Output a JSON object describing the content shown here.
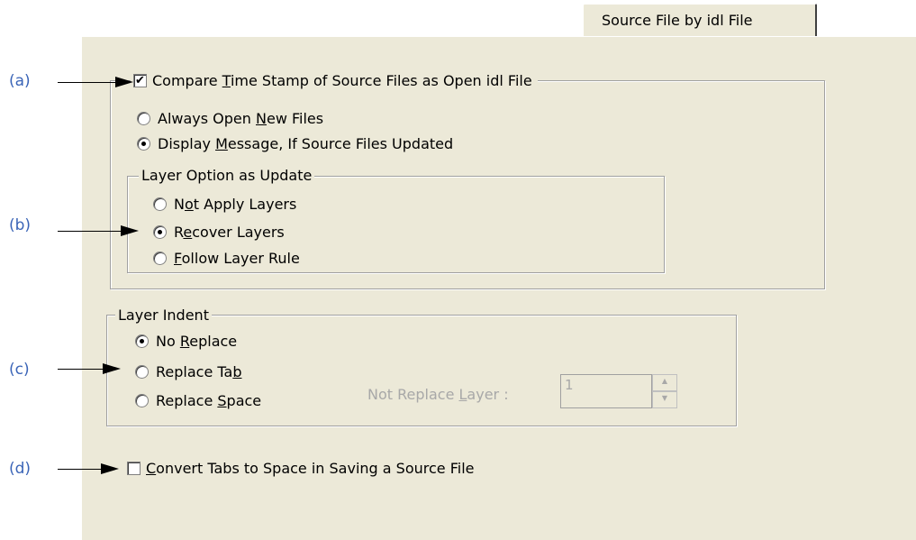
{
  "tab": {
    "label": "Source File by idl File"
  },
  "annotations": {
    "a": "(a)",
    "b": "(b)",
    "c": "(c)",
    "d": "(d)"
  },
  "compare": {
    "checked": true,
    "check_glyph": "✔",
    "label_pre": "Compare ",
    "label_ul": "T",
    "label_post": "ime Stamp of Source Files as Open idl File"
  },
  "open_options": [
    {
      "pre": "Always Open ",
      "ul": "N",
      "post": "ew Files",
      "selected": false
    },
    {
      "pre": "Display ",
      "ul": "M",
      "post": "essage, If Source Files Updated",
      "selected": true
    }
  ],
  "layer_option": {
    "title": "Layer Option as Update",
    "items": [
      {
        "pre": "N",
        "ul": "o",
        "post": "t Apply Layers",
        "selected": false
      },
      {
        "pre": "R",
        "ul": "e",
        "post": "cover Layers",
        "selected": true
      },
      {
        "pre": "",
        "ul": "F",
        "post": "ollow Layer Rule",
        "selected": false
      }
    ]
  },
  "layer_indent": {
    "title": "Layer Indent",
    "items": [
      {
        "pre": "No ",
        "ul": "R",
        "post": "eplace",
        "selected": true
      },
      {
        "pre": "Replace Ta",
        "ul": "b",
        "post": "",
        "selected": false
      },
      {
        "pre": "Replace ",
        "ul": "S",
        "post": "pace",
        "selected": false
      }
    ],
    "not_replace_label_pre": "Not Replace ",
    "not_replace_label_ul": "L",
    "not_replace_label_post": "ayer :",
    "not_replace_value": "1",
    "spin_up": "▲",
    "spin_down": "▼"
  },
  "convert": {
    "checked": false,
    "label_pre": "",
    "label_ul": "C",
    "label_post": "onvert Tabs to Space in Saving a Source File"
  }
}
